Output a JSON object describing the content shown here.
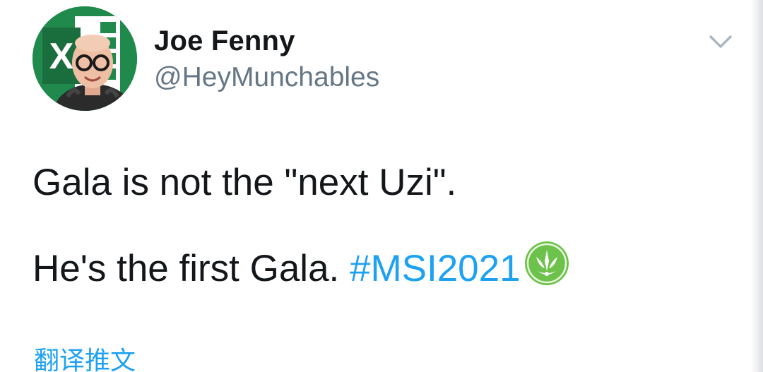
{
  "author": {
    "display_name": "Joe Fenny",
    "handle": "@HeyMunchables",
    "avatar_icon": "excel-logo-portrait-avatar"
  },
  "tweet": {
    "line1": "Gala is not the \"next Uzi\".",
    "line2_text": "He's the first Gala. ",
    "hashtag": "#MSI2021",
    "hashtag_icon": "msi-emblem-icon"
  },
  "actions": {
    "menu_icon": "chevron-down-icon",
    "translate_label": "翻译推文"
  },
  "colors": {
    "text_primary": "#14171a",
    "text_secondary": "#657786",
    "link": "#1da1f2",
    "excel_green": "#1d7a45",
    "emblem_green": "#6cc24a"
  }
}
